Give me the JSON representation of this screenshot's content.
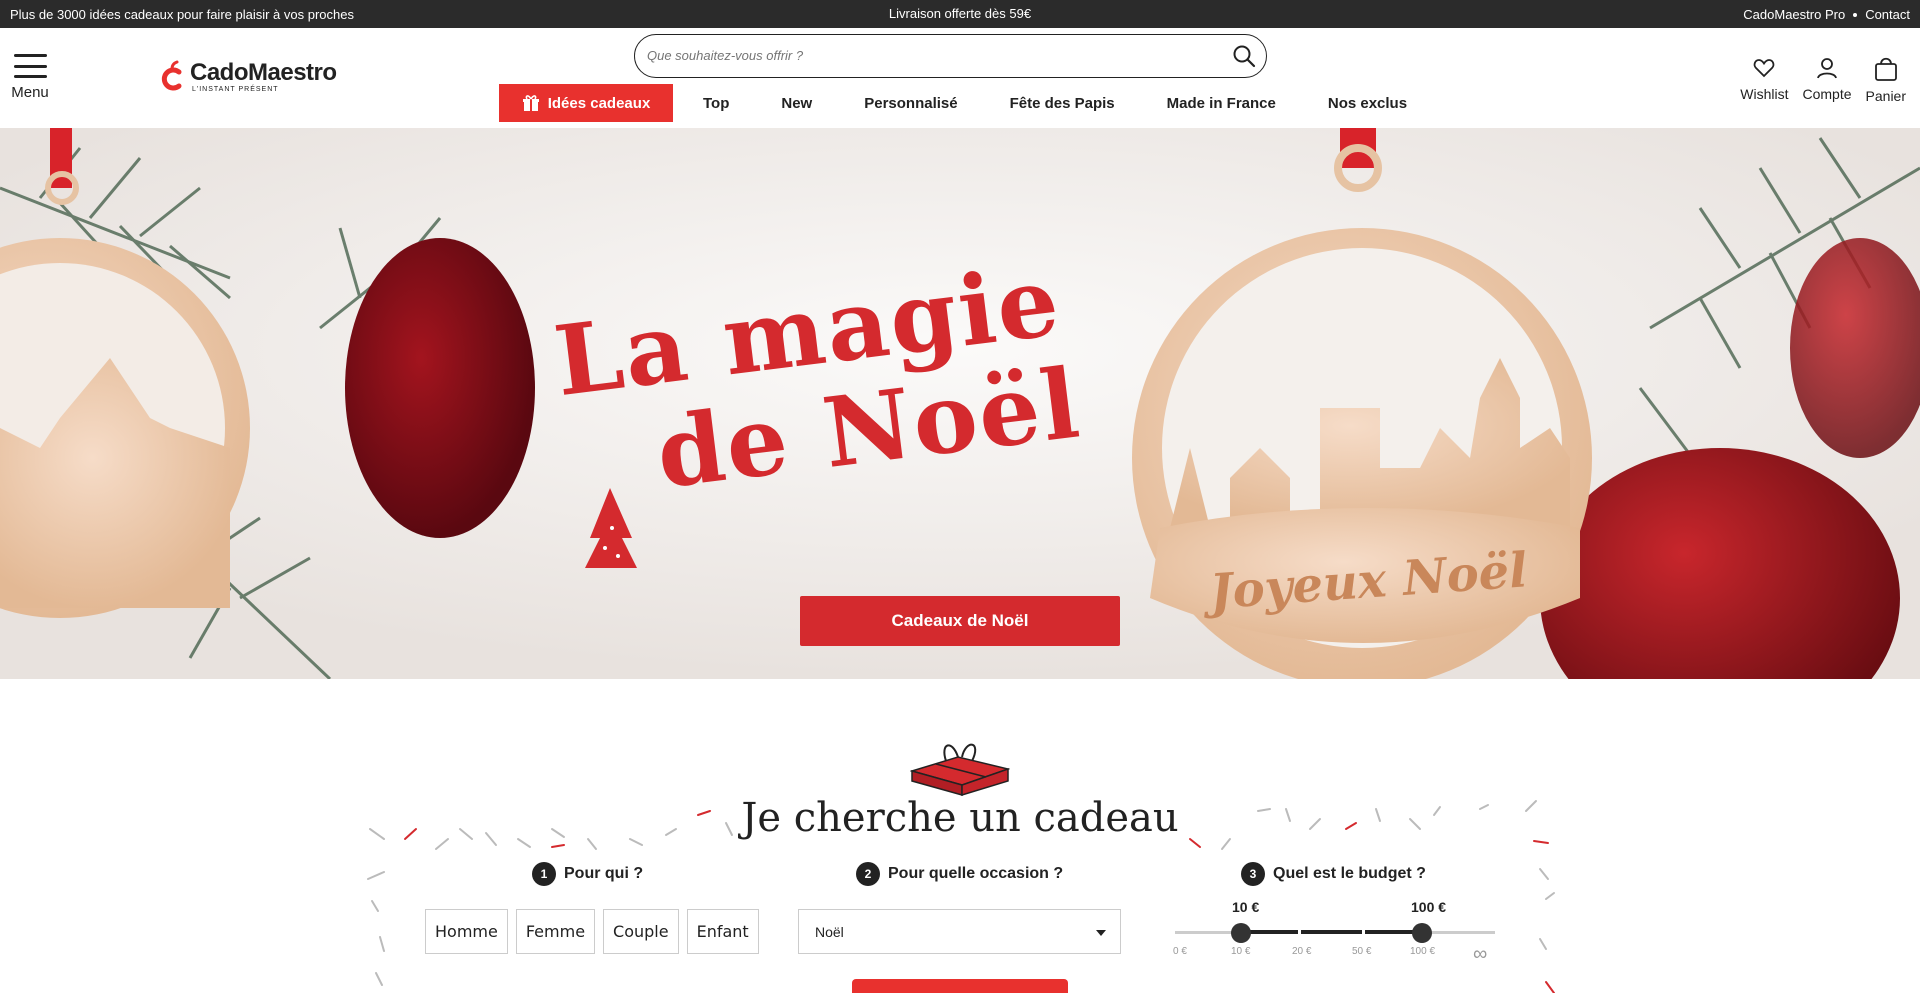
{
  "topbar": {
    "promo": "Plus de 3000 idées cadeaux pour faire plaisir à vos proches",
    "shipping": "Livraison offerte dès 59€",
    "pro": "CadoMaestro Pro",
    "contact": "Contact"
  },
  "header": {
    "menu_label": "Menu",
    "logo_name": "CadoMaestro",
    "logo_tagline": "L'INSTANT PRÉSENT",
    "search_placeholder": "Que souhaitez-vous offrir ?",
    "wishlist": "Wishlist",
    "account": "Compte",
    "cart": "Panier"
  },
  "nav": {
    "gift_ideas": "Idées cadeaux",
    "items": [
      "Top",
      "New",
      "Personnalisé",
      "Fête des Papis",
      "Made in France",
      "Nos exclus"
    ]
  },
  "hero": {
    "title_line1": "La magie",
    "title_line2": "de Noël",
    "ornament_text": "Joyeux Noël",
    "cta": "Cadeaux de Noël",
    "colors": {
      "accent": "#d42a2e"
    }
  },
  "finder": {
    "title": "Je cherche un cadeau",
    "steps": [
      {
        "num": "1",
        "label": "Pour qui ?"
      },
      {
        "num": "2",
        "label": "Pour quelle occasion ?"
      },
      {
        "num": "3",
        "label": "Quel est le budget ?"
      }
    ],
    "who_options": [
      "Homme",
      "Femme",
      "Couple",
      "Enfant"
    ],
    "occasion_selected": "Noël",
    "budget": {
      "min_value": "10 €",
      "max_value": "100 €",
      "tick_labels": [
        "0 €",
        "10 €",
        "20 €",
        "50 €",
        "100 €"
      ],
      "infinity": "∞"
    }
  }
}
